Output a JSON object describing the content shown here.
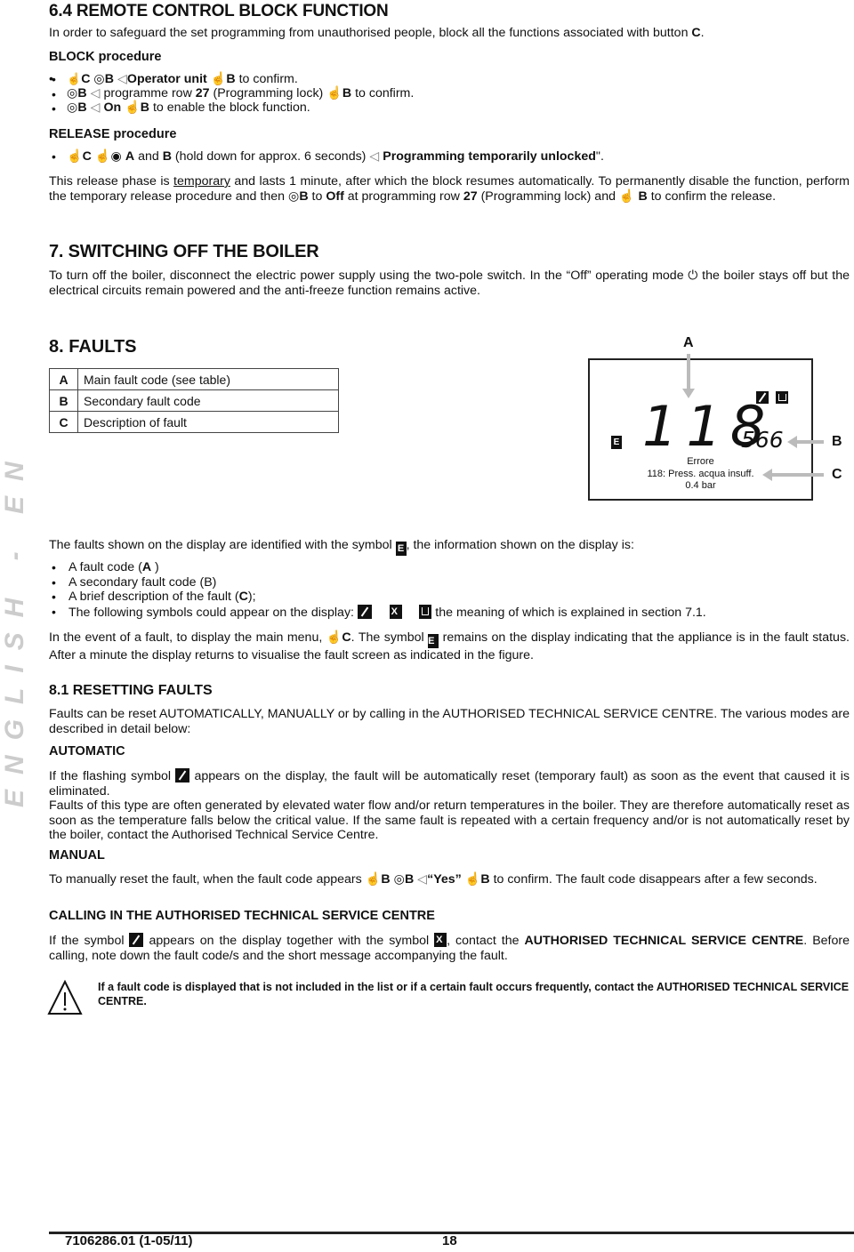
{
  "side_label": "ENGLISH - EN",
  "section_6_4": {
    "title": "6.4     REMOTE CONTROL BLOCK FUNCTION",
    "intro": "In order to safeguard the set programming from unauthorised people, block all the functions associated with button ",
    "intro_bold": "C",
    "block_heading": "BLOCK procedure",
    "block_steps": [
      {
        "parts": [
          "C",
          "B",
          "Operator unit",
          "B",
          " to confirm."
        ]
      },
      {
        "parts": [
          "B",
          "programme row ",
          "27",
          " (Programming lock)",
          "B",
          "  to confirm."
        ]
      },
      {
        "parts": [
          "B",
          "On",
          "B",
          "  to enable the block function."
        ]
      }
    ],
    "release_heading": "RELEASE procedure",
    "release_step": {
      "c": "C",
      "a": "A",
      "and": " and ",
      "b": "B",
      "hold": " (hold down for approx. 6 seconds)",
      "msg": "Programming temporarily unlocked",
      "end": "\"."
    },
    "release_note": {
      "t1": "This release phase is ",
      "temporary": "temporary",
      "t2": " and lasts 1 minute, after which the block resumes automatically. To permanently disable the function, perform the temporary release procedure and then ",
      "b1": "B",
      "t3": " to ",
      "off": "Off",
      "t4": " at programming row ",
      "row": "27",
      "t5": " (Programming lock)  and ",
      "b2": "B",
      "t6": " to confirm the release."
    }
  },
  "section_7": {
    "title": "7.   SWITCHING OFF THE BOILER",
    "text1": "To turn off the boiler, disconnect the electric power supply using the two-pole switch. In the “Off” operating mode ",
    "text2": " the boiler stays off but the electrical circuits remain powered and the anti-freeze function remains active."
  },
  "section_8": {
    "title": "8.   FAULTS",
    "legend": [
      {
        "key": "A",
        "desc": "Main fault code (see table)"
      },
      {
        "key": "B",
        "desc": "Secondary fault code"
      },
      {
        "key": "C",
        "desc": "Description of fault"
      }
    ],
    "display": {
      "label_a": "A",
      "label_b": "B",
      "label_c": "C",
      "error_symbol": "E",
      "main_code": "118",
      "secondary_code": "566",
      "line1": "Errore",
      "line2": "118: Press. acqua insuff.",
      "line3": "0.4 bar"
    },
    "intro1": "The faults shown on the display are identified with the symbol ",
    "intro2": ", the information shown on the display is:",
    "bullets": [
      {
        "pre": "A fault code (",
        "bold": "A",
        "post": " )"
      },
      {
        "pre": "A secondary fault code (B)",
        "bold": "",
        "post": ""
      },
      {
        "pre": "A brief description of the fault (",
        "bold": "C",
        "post": ");"
      },
      {
        "pre": "The following symbols could appear on the display: ",
        "bold": "",
        "post": " the meaning of which is explained in section 7.1."
      }
    ],
    "event1": "In the event of a fault, to display the main menu, ",
    "event_c": "C",
    "event2": ". The symbol ",
    "event3": " remains on the display indicating that the appliance is in the fault status. After a minute the display returns to visualise the fault screen as indicated in the figure."
  },
  "section_8_1": {
    "title": "8.1     RESETTING FAULTS",
    "intro": "Faults can be reset AUTOMATICALLY, MANUALLY or by calling in the AUTHORISED TECHNICAL SERVICE CENTRE. The various modes are described in detail below:",
    "automatic_heading": "AUTOMATIC",
    "automatic_p1a": "If the flashing symbol ",
    "automatic_p1b": " appears on the display, the fault will be automatically reset (temporary fault) as soon as the event that caused it is eliminated.",
    "automatic_p2": "Faults of this type are often generated by elevated water flow and/or return temperatures in the boiler. They are therefore automatically reset as soon as the temperature falls below the critical value. If the same fault is repeated with a certain frequency and/or is not automatically reset by the boiler, contact the Authorised Technical Service Centre.",
    "manual_heading": "MANUAL",
    "manual_p1": "To manually reset the fault, when the fault code appears ",
    "manual_b": "B",
    "manual_yes": "“Yes”",
    "manual_p2": " to confirm. The fault code disappears after a few seconds.",
    "service_heading": "CALLING IN THE AUTHORISED TECHNICAL SERVICE CENTRE",
    "service_p1": "If the symbol ",
    "service_p2": " appears on the display together with the symbol ",
    "service_p3": ", contact the ",
    "service_bold": "AUTHORISED TECHNICAL SERVICE CENTRE",
    "service_p4": ". Before calling, note down the fault code/s and the short message accompanying the fault.",
    "warning": "If a fault code is displayed that is not included in the list or if a certain fault occurs frequently, contact the AUTHORISED TECHNICAL SERVICE CENTRE."
  },
  "footer": {
    "doc_code": "7106286.01 (1-05/11)",
    "page_number": "18"
  }
}
